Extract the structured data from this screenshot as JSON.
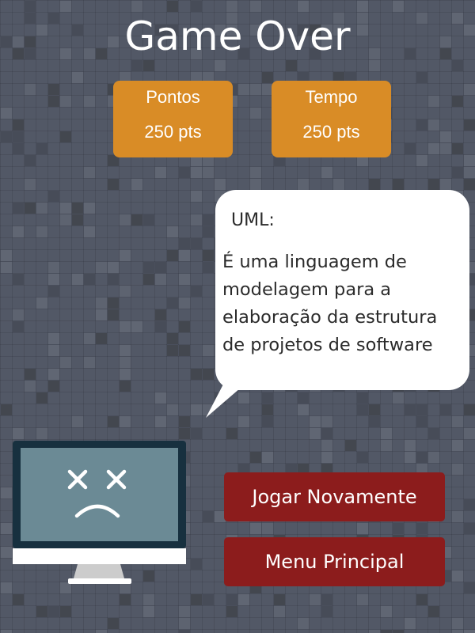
{
  "title": "Game Over",
  "stats": {
    "points": {
      "label": "Pontos",
      "value": "250 pts"
    },
    "time": {
      "label": "Tempo",
      "value": "250 pts"
    }
  },
  "bubble": {
    "heading": "UML:",
    "lines": [
      "É uma linguagem de",
      "modelagem para a",
      "elaboração da estrutura",
      "de projetos de software"
    ]
  },
  "monitor": {
    "icon": "sad-computer-icon"
  },
  "buttons": {
    "replay": "Jogar Novamente",
    "menu": "Menu Principal"
  },
  "colors": {
    "background": "#525866",
    "stat_card": "#d98c26",
    "button": "#8c1c1c",
    "monitor_screen": "#6b8a95",
    "monitor_frame": "#17303f"
  }
}
